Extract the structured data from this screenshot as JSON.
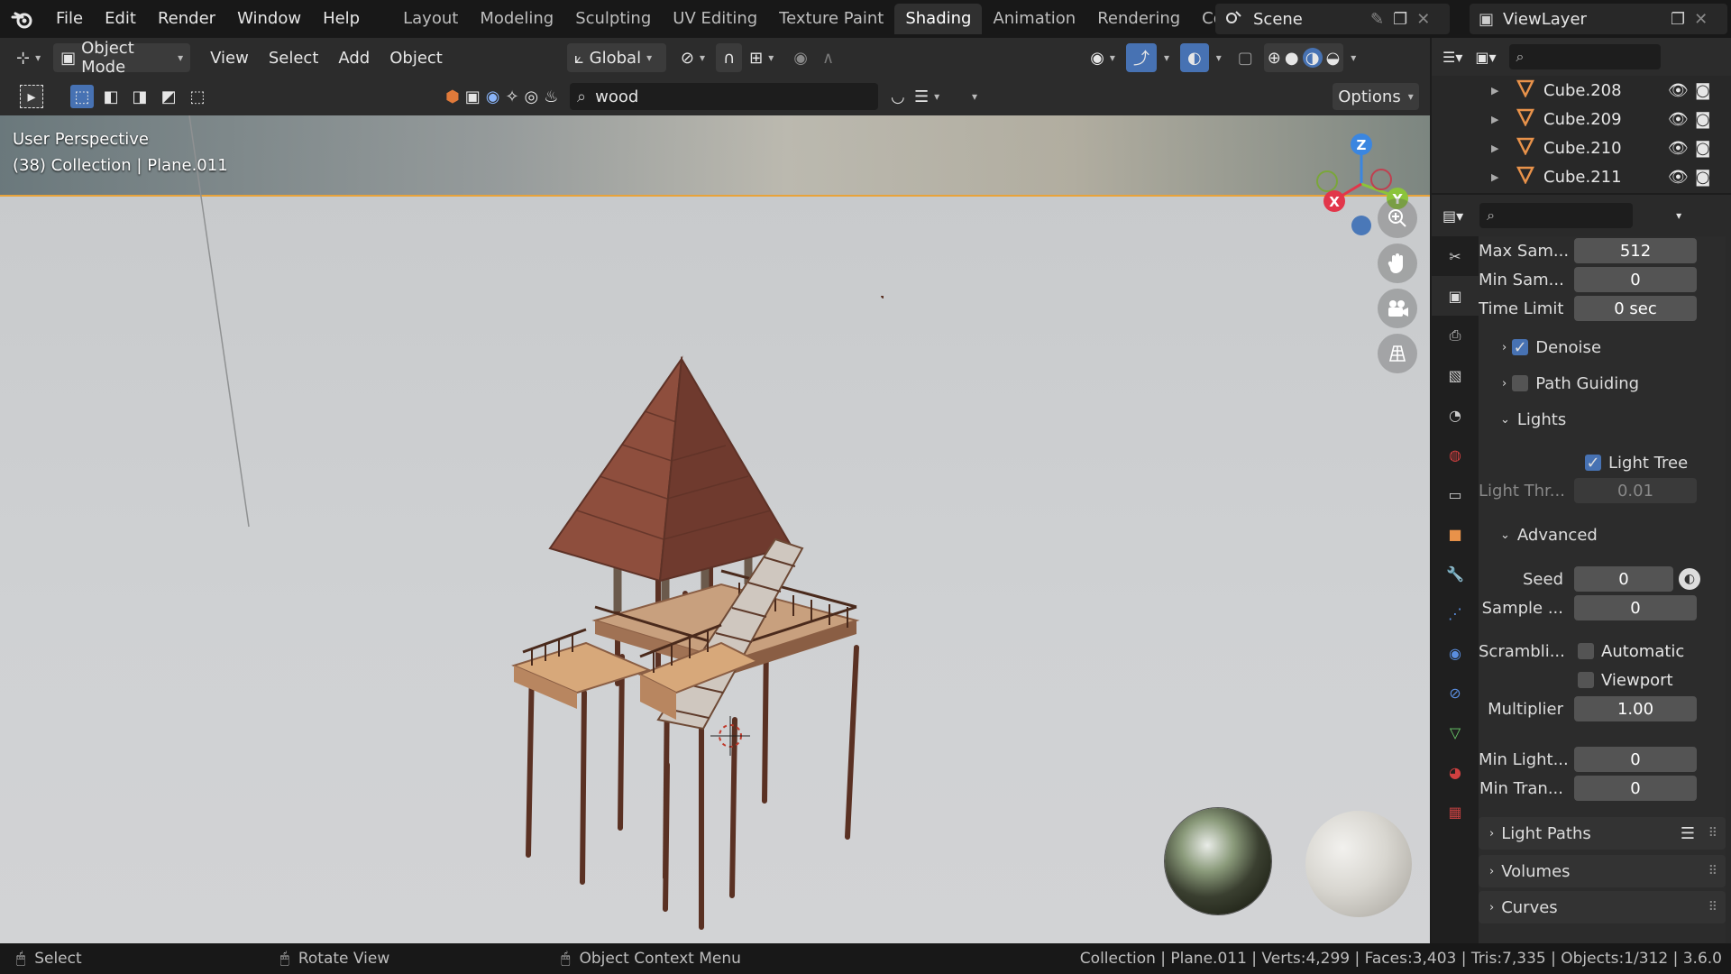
{
  "topbar": {
    "menus": [
      "File",
      "Edit",
      "Render",
      "Window",
      "Help"
    ],
    "workspaces": [
      "Layout",
      "Modeling",
      "Sculpting",
      "UV Editing",
      "Texture Paint",
      "Shading",
      "Animation",
      "Rendering",
      "Compositing"
    ],
    "active_workspace": "Shading",
    "scene_name": "Scene",
    "view_layer_name": "ViewLayer"
  },
  "viewport_header": {
    "mode": "Object Mode",
    "menus": [
      "View",
      "Select",
      "Add",
      "Object"
    ],
    "transform_orientation": "Global",
    "search_value": "wood",
    "options_label": "Options"
  },
  "viewport": {
    "perspective_label": "User Perspective",
    "collection_label": "(38) Collection | Plane.011",
    "gizmo": {
      "x": "X",
      "y": "Y",
      "z": "Z"
    },
    "colors": {
      "x_axis": "#e2364a",
      "y_axis": "#8bc43a",
      "z_axis": "#3b86e0",
      "active_outline": "#e8a33a"
    }
  },
  "outliner": {
    "items": [
      {
        "name": "Cube.208"
      },
      {
        "name": "Cube.209"
      },
      {
        "name": "Cube.210"
      },
      {
        "name": "Cube.211"
      }
    ]
  },
  "properties": {
    "fields": {
      "max_samples": {
        "label": "Max Sam...",
        "value": "512"
      },
      "min_samples": {
        "label": "Min Sam...",
        "value": "0"
      },
      "time_limit": {
        "label": "Time Limit",
        "value": "0 sec"
      },
      "light_threshold": {
        "label": "Light Thr...",
        "value": "0.01"
      },
      "seed": {
        "label": "Seed",
        "value": "0"
      },
      "sample_offset": {
        "label": "Sample ...",
        "value": "0"
      },
      "scrambling": {
        "label": "Scrambli..."
      },
      "multiplier": {
        "label": "Multiplier",
        "value": "1.00"
      },
      "min_light_bounces": {
        "label": "Min Light...",
        "value": "0"
      },
      "min_transparent_bounces": {
        "label": "Min Tran...",
        "value": "0"
      }
    },
    "checks": {
      "denoise": {
        "label": "Denoise",
        "checked": true
      },
      "path_guiding": {
        "label": "Path Guiding",
        "checked": false
      },
      "light_tree": {
        "label": "Light Tree",
        "checked": true
      },
      "automatic": {
        "label": "Automatic",
        "checked": false
      },
      "viewport": {
        "label": "Viewport",
        "checked": false
      }
    },
    "subpanels": {
      "lights": "Lights",
      "advanced": "Advanced"
    },
    "panels": {
      "light_paths": "Light Paths",
      "volumes": "Volumes",
      "curves": "Curves"
    }
  },
  "statusbar": {
    "select": "Select",
    "rotate_view": "Rotate View",
    "context_menu": "Object Context Menu",
    "stats": "Collection | Plane.011 | Verts:4,299 | Faces:3,403 | Tris:7,335 | Objects:1/312 | 3.6.0"
  }
}
